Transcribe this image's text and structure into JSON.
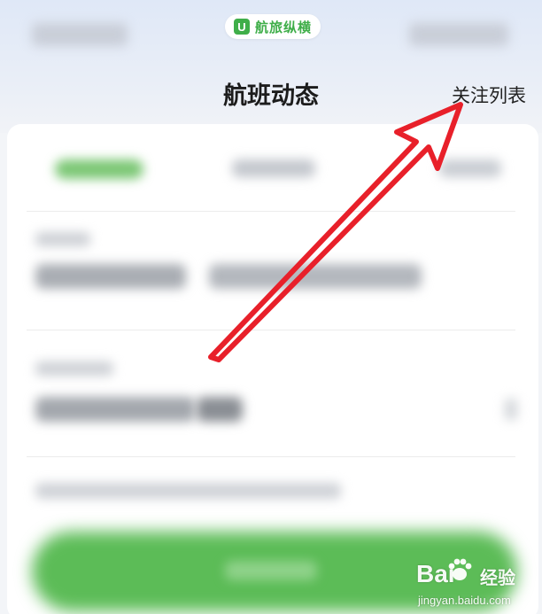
{
  "header": {
    "logo_glyph": "U",
    "logo_text": "航旅纵横",
    "title": "航班动态",
    "follow_list_label": "关注列表"
  },
  "watermark": {
    "brand_left": "Bai",
    "brand_right": "经验",
    "url": "jingyan.baidu.com"
  },
  "colors": {
    "accent_green": "#3fae49",
    "annotation_red": "#e8202a"
  }
}
